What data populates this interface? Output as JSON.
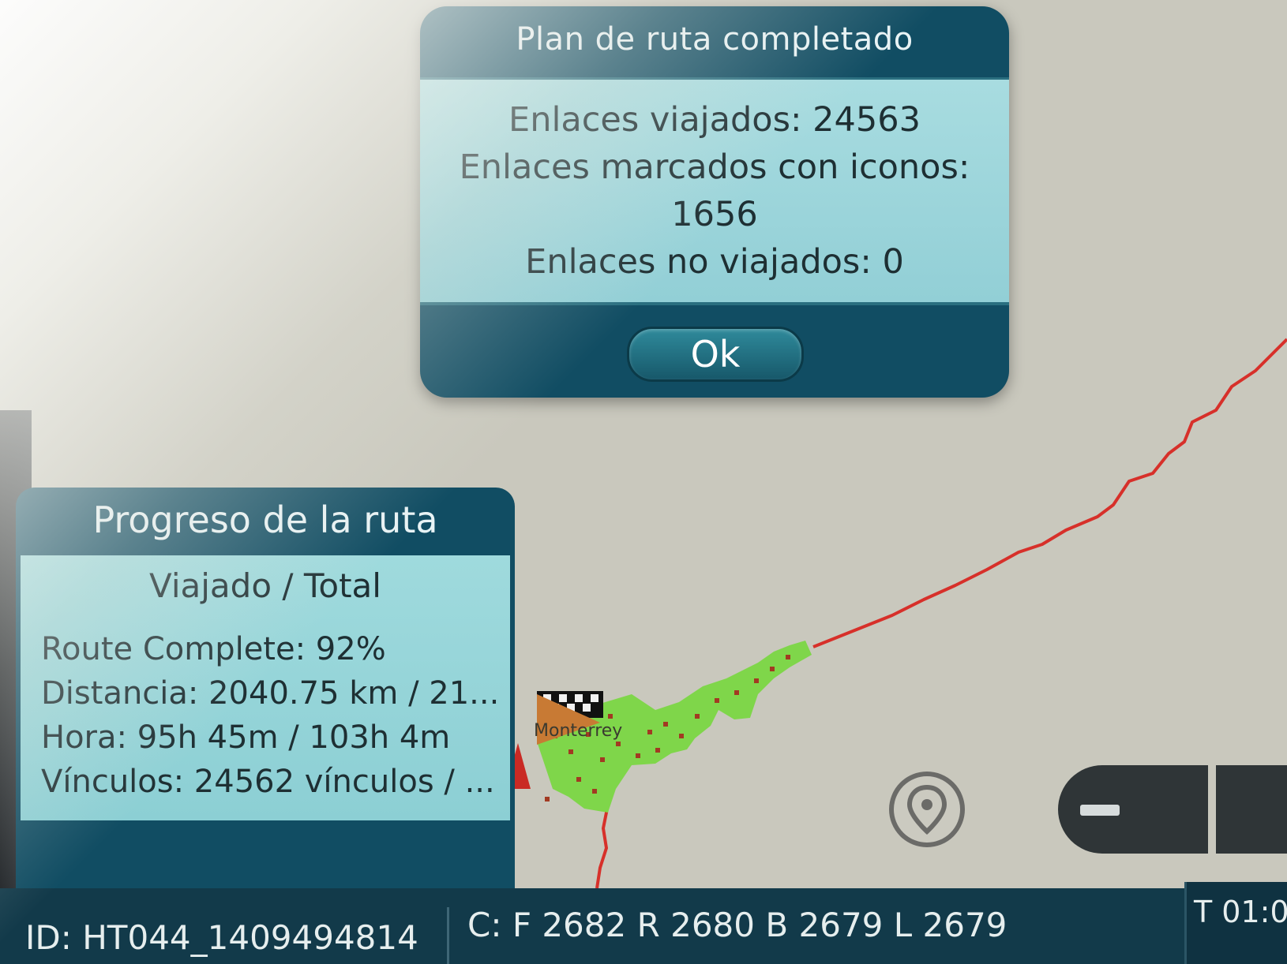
{
  "dialog": {
    "title": "Plan de ruta completado",
    "lines": [
      "Enlaces viajados: 24563",
      "Enlaces marcados con iconos:",
      "1656",
      "Enlaces no viajados: 0"
    ],
    "ok_label": "Ok"
  },
  "progress_panel": {
    "title": "Progreso de la ruta",
    "subtitle": "Viajado / Total",
    "rows": [
      "Route Complete: 92%",
      "Distancia: 2040.75 km / 21...",
      "Hora: 95h 45m / 103h 4m",
      "Vínculos: 24562 vínculos / ..."
    ]
  },
  "map": {
    "city_label": "Monterrey",
    "colors": {
      "route": "#d7302a",
      "covered_area": "#7fd64a",
      "links": "#a23a22",
      "background": "#c9c8bd"
    },
    "icons": [
      "finish-flag-icon",
      "current-position-icon",
      "location-pin-icon"
    ]
  },
  "controls": {
    "zoom_out_symbol": "−"
  },
  "status_bar": {
    "id": "ID: HT044_1409494814",
    "counts": "C: F 2682 R 2680 B 2679 L 2679",
    "time": "T 01:0"
  }
}
